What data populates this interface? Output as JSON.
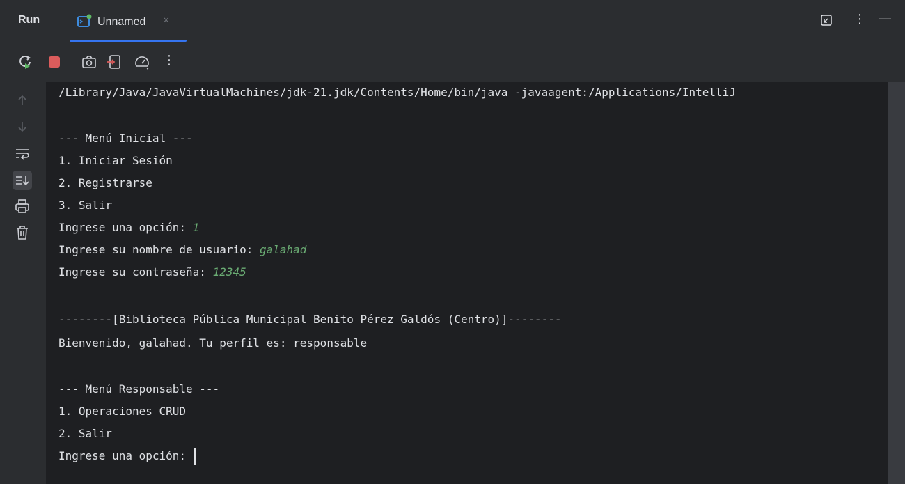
{
  "header": {
    "title": "Run",
    "tab": {
      "label": "Unnamed",
      "close": "×"
    },
    "right_more": "⋮",
    "right_minimize": "—"
  },
  "toolbar": {
    "more": "⋮"
  },
  "console": {
    "command": "/Library/Java/JavaVirtualMachines/jdk-21.jdk/Contents/Home/bin/java -javaagent:/Applications/IntelliJ",
    "lines": [
      "--- Menú Inicial ---",
      "1. Iniciar Sesión",
      "2. Registrarse",
      "3. Salir"
    ],
    "prompt_option": "Ingrese una opción: ",
    "input_option": "1",
    "prompt_user": "Ingrese su nombre de usuario: ",
    "input_user": "galahad",
    "prompt_pass": "Ingrese su contraseña: ",
    "input_pass": "12345",
    "banner": "--------[Biblioteca Pública Municipal Benito Pérez Galdós (Centro)]--------",
    "welcome": "Bienvenido, galahad. Tu perfil es: responsable",
    "menu2": [
      "--- Menú Responsable ---",
      "1. Operaciones CRUD",
      "2. Salir"
    ],
    "prompt_final": "Ingrese una opción: "
  },
  "colors": {
    "background": "#2b2d30",
    "console_bg": "#1e1f22",
    "accent": "#3574f0",
    "input_text": "#6aab73",
    "stop_red": "#db5c5c",
    "rerun_green": "#5fb865"
  }
}
